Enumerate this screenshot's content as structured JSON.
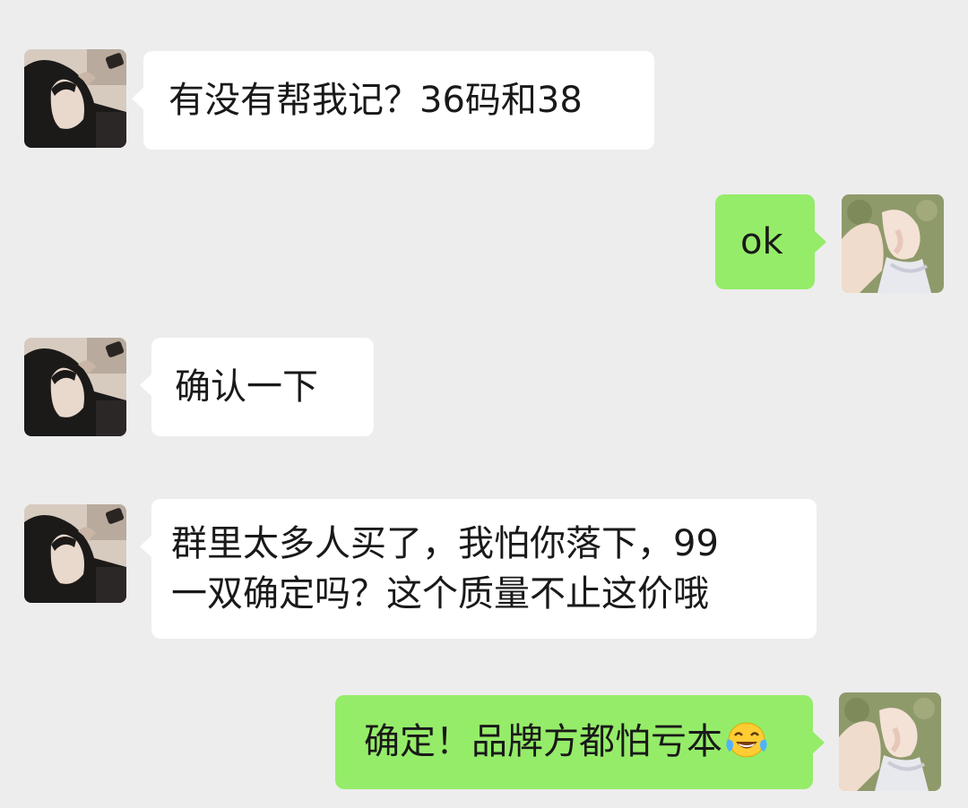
{
  "messages": [
    {
      "direction": "incoming",
      "text": "有没有帮我记？36码和38"
    },
    {
      "direction": "outgoing",
      "text": "ok"
    },
    {
      "direction": "incoming",
      "text": "确认一下"
    },
    {
      "direction": "incoming",
      "lines": [
        "群里太多人买了，我怕你落下，99",
        "一双确定吗？这个质量不止这价哦"
      ]
    },
    {
      "direction": "outgoing",
      "text": "确定！品牌方都怕亏本",
      "emoji": "face-with-tears-of-joy"
    }
  ],
  "icons": {
    "contact_avatar": "contact-avatar-icon",
    "my_avatar": "my-avatar-icon",
    "emoji": "face-with-tears-of-joy-icon"
  },
  "colors": {
    "background": "#ededed",
    "incoming_bubble": "#ffffff",
    "outgoing_bubble": "#95ec69",
    "text": "#191919"
  }
}
